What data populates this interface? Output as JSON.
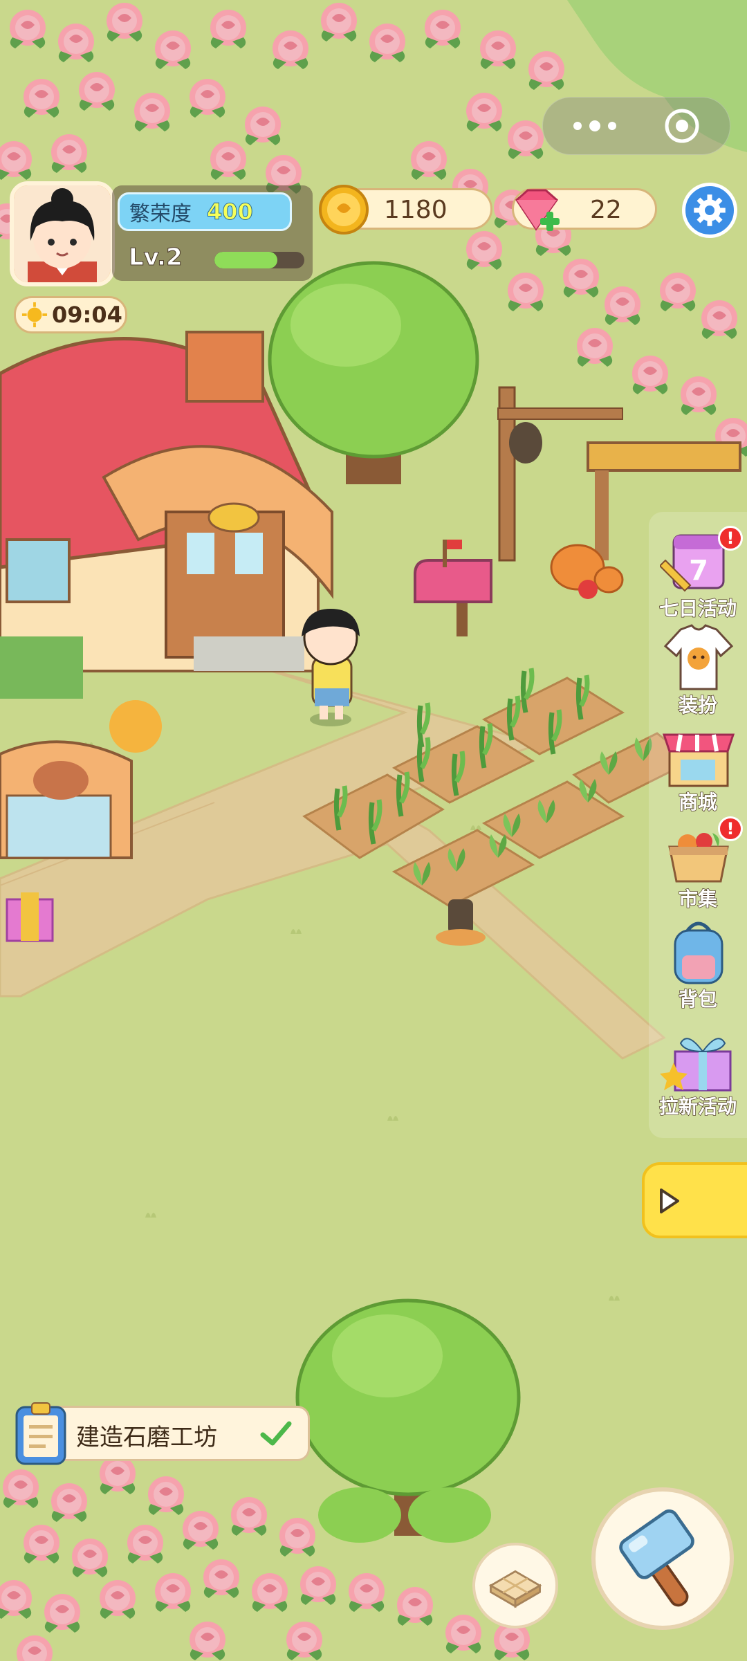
{
  "player": {
    "prosperity_label": "繁荣度",
    "prosperity_value": "400",
    "level": "Lv.2",
    "exp_progress": 0.7
  },
  "time": "09:04",
  "currency": {
    "coins": "1180",
    "gems": "22"
  },
  "side_menu": [
    {
      "label": "七日活动",
      "icon": "calendar-icon",
      "badge": "!"
    },
    {
      "label": "装扮",
      "icon": "shirt-icon",
      "badge": ""
    },
    {
      "label": "商城",
      "icon": "shop-icon",
      "badge": ""
    },
    {
      "label": "市集",
      "icon": "basket-icon",
      "badge": "!"
    },
    {
      "label": "背包",
      "icon": "backpack-icon",
      "badge": ""
    },
    {
      "label": "拉新活动",
      "icon": "gift-icon",
      "badge": ""
    }
  ],
  "quest": {
    "text": "建造石磨工坊",
    "completed": true
  },
  "colors": {
    "grass": "#c9d88c",
    "path": "#e2c99a",
    "accent_blue": "#3b8ee6",
    "badge_red": "#ef2d2d"
  }
}
